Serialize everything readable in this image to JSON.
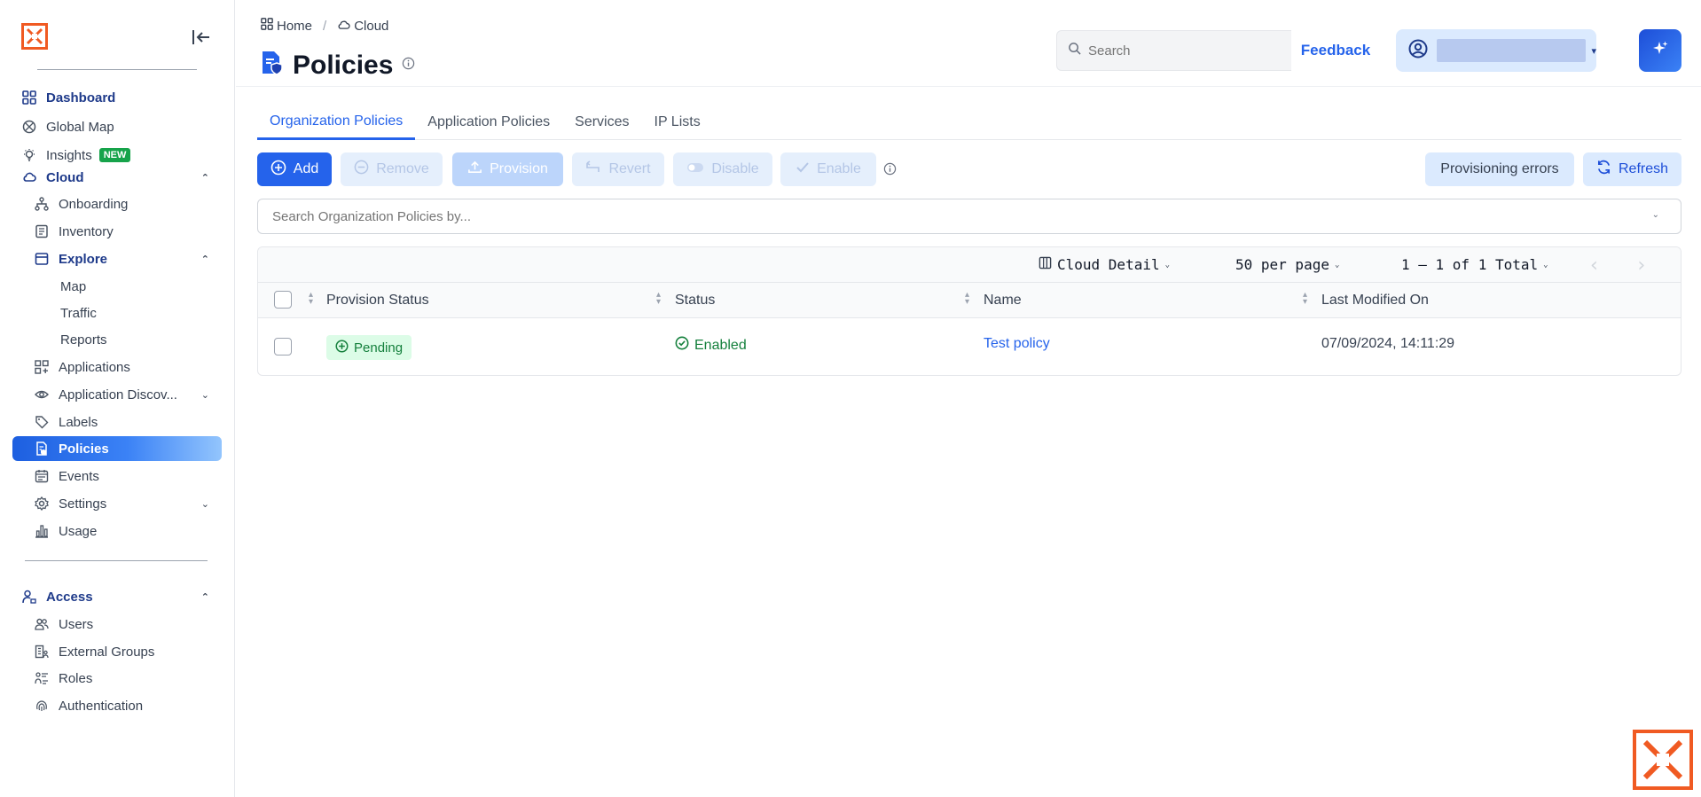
{
  "brand": {
    "accent": "#f05a22",
    "primary": "#2563eb"
  },
  "sidebar": {
    "items": [
      {
        "label": "Dashboard",
        "icon": "grid-icon"
      },
      {
        "label": "Global Map",
        "icon": "globe-icon"
      },
      {
        "label": "Insights",
        "icon": "lightbulb-icon",
        "badge": "NEW"
      },
      {
        "label": "Cloud",
        "icon": "cloud-icon"
      },
      {
        "label": "Onboarding",
        "icon": "hierarchy-icon"
      },
      {
        "label": "Inventory",
        "icon": "list-icon"
      },
      {
        "label": "Explore",
        "icon": "box-icon"
      },
      {
        "label": "Map"
      },
      {
        "label": "Traffic"
      },
      {
        "label": "Reports"
      },
      {
        "label": "Applications",
        "icon": "apps-icon"
      },
      {
        "label": "Application Discov...",
        "icon": "eye-icon"
      },
      {
        "label": "Labels",
        "icon": "tag-icon"
      },
      {
        "label": "Policies",
        "icon": "policy-icon"
      },
      {
        "label": "Events",
        "icon": "calendar-icon"
      },
      {
        "label": "Settings",
        "icon": "gear-icon"
      },
      {
        "label": "Usage",
        "icon": "bar-chart-icon"
      },
      {
        "label": "Access",
        "icon": "user-lock-icon"
      },
      {
        "label": "Users",
        "icon": "users-icon"
      },
      {
        "label": "External Groups",
        "icon": "building-icon"
      },
      {
        "label": "Roles",
        "icon": "roles-icon"
      },
      {
        "label": "Authentication",
        "icon": "fingerprint-icon"
      }
    ]
  },
  "header": {
    "breadcrumb": [
      "Home",
      "Cloud"
    ],
    "title": "Policies",
    "search_placeholder": "Search",
    "feedback_label": "Feedback"
  },
  "tabs": [
    "Organization Policies",
    "Application Policies",
    "Services",
    "IP Lists"
  ],
  "toolbar": {
    "add": "Add",
    "remove": "Remove",
    "provision": "Provision",
    "revert": "Revert",
    "disable": "Disable",
    "enable": "Enable",
    "provisioning_errors": "Provisioning errors",
    "refresh": "Refresh"
  },
  "filter": {
    "placeholder": "Search Organization Policies by..."
  },
  "table": {
    "view": "Cloud Detail",
    "per_page": "50 per page",
    "range": "1 – 1 of 1 Total",
    "columns": [
      "Provision Status",
      "Status",
      "Name",
      "Last Modified On"
    ],
    "rows": [
      {
        "provision_status": "Pending",
        "status": "Enabled",
        "name": "Test policy",
        "modified": "07/09/2024, 14:11:29"
      }
    ]
  }
}
